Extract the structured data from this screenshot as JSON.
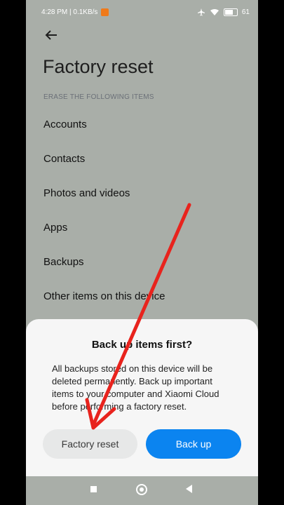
{
  "status_bar": {
    "time_speed": "4:28 PM | 0.1KB/s",
    "battery": "61",
    "battery_level": 0.61
  },
  "header": {
    "title": "Factory reset"
  },
  "section": {
    "label": "ERASE THE FOLLOWING ITEMS"
  },
  "items": [
    {
      "label": "Accounts"
    },
    {
      "label": "Contacts"
    },
    {
      "label": "Photos and videos"
    },
    {
      "label": "Apps"
    },
    {
      "label": "Backups"
    },
    {
      "label": "Other items on this device"
    }
  ],
  "dialog": {
    "title": "Back up items first?",
    "message": "All backups stored on this device will be deleted permanently. Back up important items to your computer and Xiaomi Cloud before performing a factory reset.",
    "factory_reset_label": "Factory reset",
    "back_up_label": "Back up"
  },
  "colors": {
    "accent": "#0b84f0",
    "annotation_arrow": "#e8231d"
  }
}
